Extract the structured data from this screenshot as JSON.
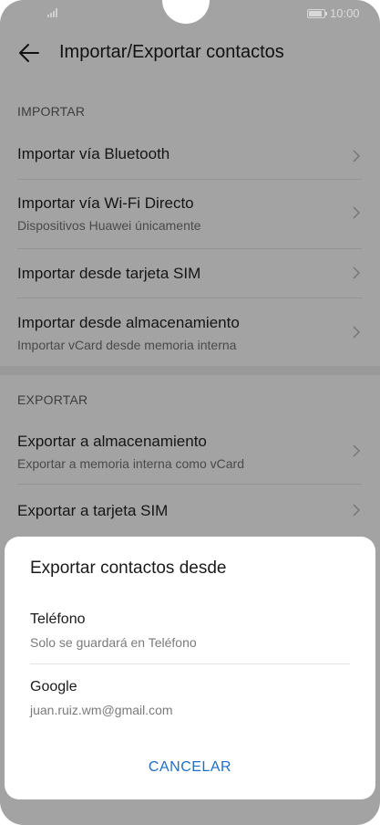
{
  "status_bar": {
    "time": "10:00",
    "signal_icon": "signal-bars-icon",
    "battery_icon": "battery-icon"
  },
  "header": {
    "title": "Importar/Exportar contactos",
    "back_icon": "arrow-left-icon"
  },
  "import_section": {
    "label": "IMPORTAR",
    "items": [
      {
        "title": "Importar vía Bluetooth",
        "subtitle": ""
      },
      {
        "title": "Importar vía Wi-Fi Directo",
        "subtitle": "Dispositivos Huawei únicamente"
      },
      {
        "title": "Importar desde tarjeta SIM",
        "subtitle": ""
      },
      {
        "title": "Importar desde almacenamiento",
        "subtitle": "Importar vCard desde memoria interna"
      }
    ]
  },
  "export_section": {
    "label": "EXPORTAR",
    "items": [
      {
        "title": "Exportar a almacenamiento",
        "subtitle": "Exportar a memoria interna como vCard"
      },
      {
        "title": "Exportar a tarjeta SIM",
        "subtitle": ""
      }
    ]
  },
  "dialog": {
    "title": "Exportar contactos desde",
    "options": [
      {
        "title": "Teléfono",
        "subtitle": "Solo se guardará en Teléfono"
      },
      {
        "title": "Google",
        "subtitle": "juan.ruiz.wm@gmail.com"
      }
    ],
    "cancel_label": "CANCELAR"
  },
  "colors": {
    "accent": "#1f6fc6",
    "scrim": "#a3a3a3",
    "dialog_bg": "#ffffff"
  }
}
